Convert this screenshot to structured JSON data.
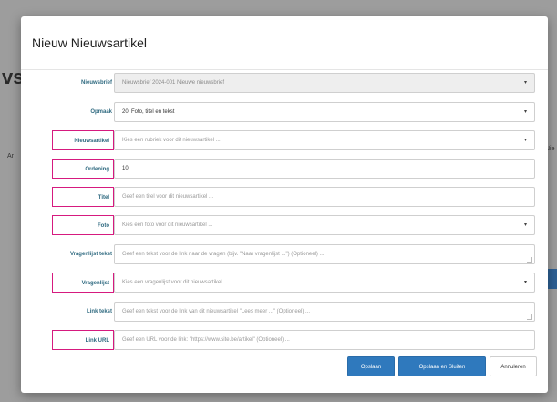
{
  "dialog": {
    "title": "Nieuw Nieuwsartikel"
  },
  "background": {
    "fragment_left": "vs",
    "fragment_small_left": "Ar",
    "fragment_small_right": "Nie"
  },
  "fields": [
    {
      "label": "Nieuwsbrief",
      "value": "Nieuwsbrief 2024-001 Nieuwe nieuwsbrief",
      "type": "select",
      "disabled": true,
      "highlighted": false
    },
    {
      "label": "Opmaak",
      "value": "20: Foto, titel en tekst",
      "type": "select",
      "disabled": false,
      "highlighted": false
    },
    {
      "label": "Nieuwsartikel",
      "value": "Kies een rubriek voor dit nieuwsartikel ...",
      "type": "select",
      "disabled": false,
      "highlighted": true
    },
    {
      "label": "Ordening",
      "value": "10",
      "type": "input",
      "disabled": false,
      "highlighted": true
    },
    {
      "label": "Titel",
      "value": "Geef een titel voor dit nieuwsartikel ...",
      "type": "input",
      "disabled": false,
      "highlighted": true
    },
    {
      "label": "Foto",
      "value": "Kies een foto voor dit nieuwsartikel ...",
      "type": "select",
      "disabled": false,
      "highlighted": true
    },
    {
      "label": "Vragenlijst tekst",
      "value": "Geef een tekst voor de link naar de vragen (bijv. \"Naar vragenlijst ...\") (Optioneel) ...",
      "type": "textarea",
      "disabled": false,
      "highlighted": false
    },
    {
      "label": "Vragenlijst",
      "value": "Kies een vragenlijst voor dit nieuwsartikel ...",
      "type": "select",
      "disabled": false,
      "highlighted": true
    },
    {
      "label": "Link tekst",
      "value": "Geef een tekst voor de link van dit nieuwsartikel \"Lees meer ...\" (Optioneel) ...",
      "type": "textarea",
      "disabled": false,
      "highlighted": false
    },
    {
      "label": "Link URL",
      "value": "Geef een URL voor de link: \"https://www.site.be/artikel\" (Optioneel) ...",
      "type": "input",
      "disabled": false,
      "highlighted": true
    }
  ],
  "buttons": {
    "save": "Opslaan",
    "save_close": "Opslaan en Sluiten",
    "cancel": "Annuleren"
  },
  "colors": {
    "highlight_border": "#d61a7f",
    "primary": "#2f79bd",
    "label": "#2f6a80"
  }
}
